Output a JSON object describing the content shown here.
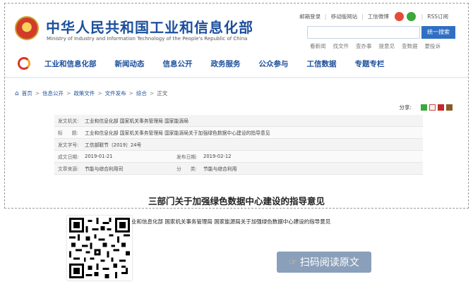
{
  "header": {
    "title": "中华人民共和国工业和信息化部",
    "subtitle": "Ministry of Industry and Information Technology of the People's Republic of China",
    "top_links": [
      "邮箱登录",
      "移动版网站",
      "工信微博"
    ],
    "rss": "RSS订阅",
    "search_button": "统一搜索",
    "quick_links": [
      "看新闻",
      "找文件",
      "查办事",
      "提意见",
      "查数据",
      "要投诉"
    ]
  },
  "nav": {
    "items": [
      "工业和信息化部",
      "新闻动态",
      "信息公开",
      "政务服务",
      "公众参与",
      "工信数据",
      "专题专栏"
    ]
  },
  "breadcrumb": [
    "首页",
    "信息公开",
    "政策文件",
    "文件发布",
    "综合",
    "正文"
  ],
  "share": {
    "label": "分享:"
  },
  "meta": {
    "issuer_label": "发文机关:",
    "issuer": "工业和信息化部 国家机关事务管理局 国家能源局",
    "title_label": "标      题:",
    "title": "工业和信息化部 国家机关事务管理局 国家能源局关于加强绿色数据中心建设的指导意见",
    "docno_label": "发文字号:",
    "docno": "工信部联节〔2019〕24号",
    "date_label": "成文日期:",
    "date": "2019-01-21",
    "pubdate_label": "发布日期:",
    "pubdate": "2019-02-12",
    "source_label": "文章来源:",
    "source": "节能与综合利用司",
    "category_label": "分      类:",
    "category": "节能与综合利用"
  },
  "document": {
    "title": "三部门关于加强绿色数据中心建设的指导意见",
    "subtitle": "业和信息化部 国家机关事务管理局 国家能源局关于加强绿色数据中心建设的指导意见"
  },
  "scan": {
    "label": "扫码阅读原文"
  },
  "colors": {
    "brand_blue": "#1c4f9c",
    "button_blue": "#2f6fc4",
    "scan_bg": "#8a9fba"
  }
}
